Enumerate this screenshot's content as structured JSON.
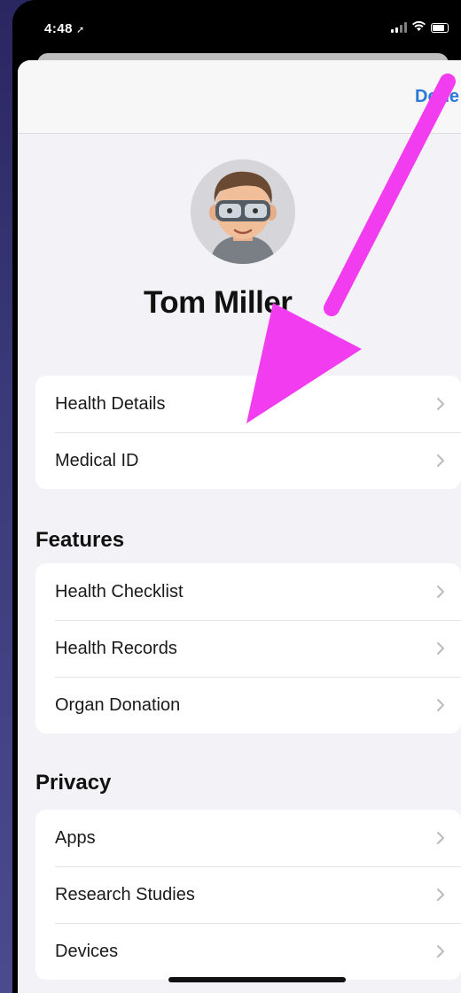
{
  "status_bar": {
    "time": "4:48",
    "location_arrow": "location-arrow-icon",
    "signal_icon": "signal-icon",
    "wifi_icon": "wifi-icon",
    "battery_icon": "battery-icon"
  },
  "navbar": {
    "done_label": "Done"
  },
  "profile": {
    "avatar_icon": "memoji-avatar-icon",
    "name": "Tom Miller"
  },
  "personal_items": [
    {
      "label": "Health Details"
    },
    {
      "label": "Medical ID"
    }
  ],
  "features": {
    "title": "Features",
    "items": [
      {
        "label": "Health Checklist"
      },
      {
        "label": "Health Records"
      },
      {
        "label": "Organ Donation"
      }
    ]
  },
  "privacy": {
    "title": "Privacy",
    "items": [
      {
        "label": "Apps"
      },
      {
        "label": "Research Studies"
      },
      {
        "label": "Devices"
      }
    ]
  },
  "colors": {
    "accent": "#2a7ad9",
    "annotation_arrow": "#f13cf0",
    "background": "#f2f2f7"
  }
}
